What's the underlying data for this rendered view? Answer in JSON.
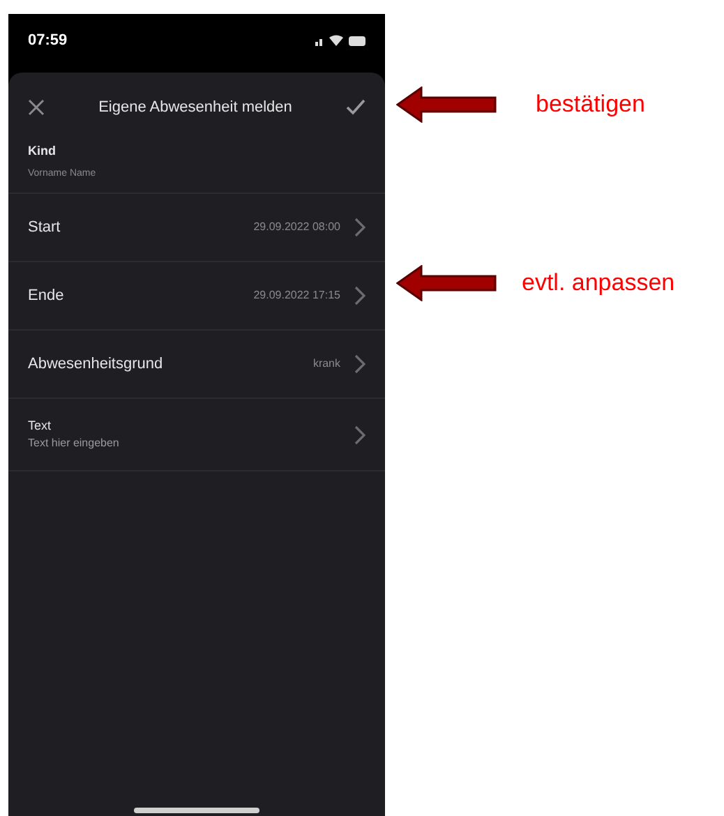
{
  "status_bar": {
    "time": "07:59"
  },
  "header": {
    "title": "Eigene Abwesenheit melden"
  },
  "child": {
    "label": "Kind",
    "value": "Vorname Name"
  },
  "rows": [
    {
      "kind": "value",
      "label": "Start",
      "value": "29.09.2022 08:00"
    },
    {
      "kind": "value",
      "label": "Ende",
      "value": "29.09.2022 17:15"
    },
    {
      "kind": "value",
      "label": "Abwesenheitsgrund",
      "value": "krank"
    },
    {
      "kind": "text",
      "label": "Text",
      "placeholder": "Text hier eingeben"
    }
  ],
  "annotations": [
    {
      "label": "bestätigen"
    },
    {
      "label": "evtl. anpassen"
    }
  ]
}
